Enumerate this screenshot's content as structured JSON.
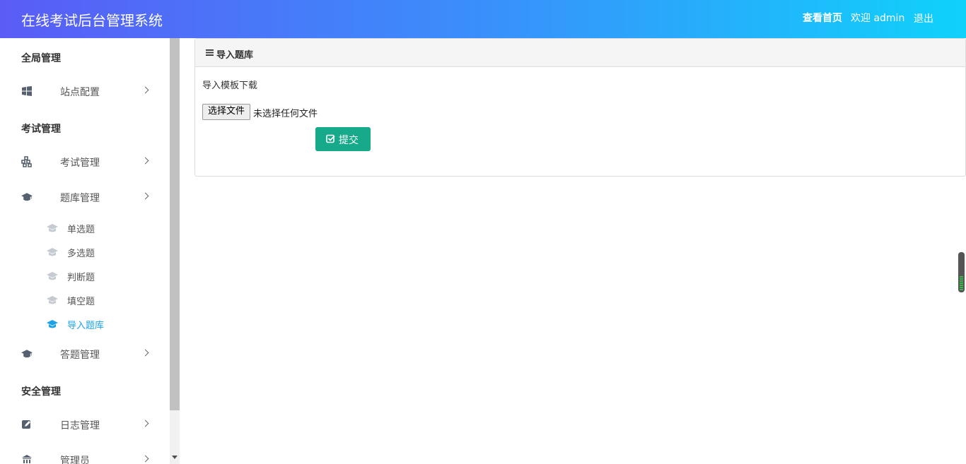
{
  "header": {
    "title": "在线考试后台管理系统",
    "home_link": "查看首页",
    "welcome": "欢迎 admin",
    "logout": "退出"
  },
  "sidebar": {
    "sections": [
      {
        "title": "全局管理",
        "items": [
          {
            "label": "站点配置",
            "icon": "windows-icon"
          }
        ]
      },
      {
        "title": "考试管理",
        "items": [
          {
            "label": "考试管理",
            "icon": "cubes-icon"
          },
          {
            "label": "题库管理",
            "icon": "graduation-cap-icon",
            "children": [
              {
                "label": "单选题"
              },
              {
                "label": "多选题"
              },
              {
                "label": "判断题"
              },
              {
                "label": "填空题"
              },
              {
                "label": "导入题库",
                "active": true
              }
            ]
          },
          {
            "label": "答题管理",
            "icon": "graduation-cap-icon"
          }
        ]
      },
      {
        "title": "安全管理",
        "items": [
          {
            "label": "日志管理",
            "icon": "edit-icon"
          },
          {
            "label": "管理员",
            "icon": "bank-icon"
          }
        ]
      }
    ]
  },
  "panel": {
    "title": "导入题库",
    "template_link": "导入模板下载",
    "file_button": "选择文件",
    "file_status": "未选择任何文件",
    "submit": "提交"
  },
  "colors": {
    "header_gradient_start": "#5a5cf6",
    "header_gradient_end": "#0fd2fb",
    "active": "#1aa3e8",
    "submit": "#16a98a"
  }
}
